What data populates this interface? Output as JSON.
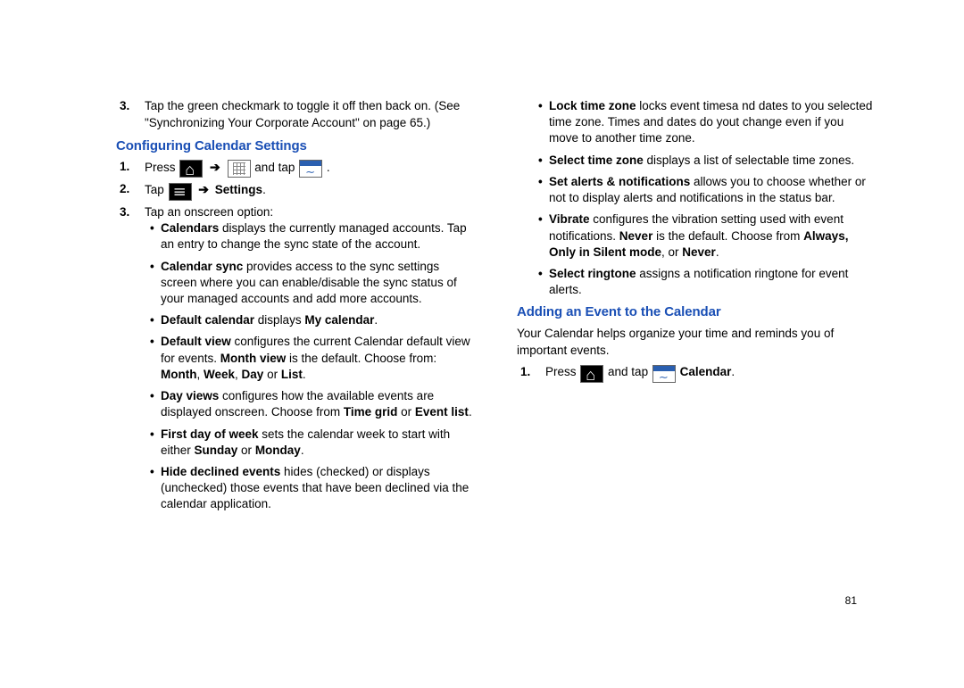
{
  "page_number": "81",
  "col1": {
    "pre_num": "3.",
    "pre_text": "Tap the green checkmark to toggle it off then back on. (See \"Synchronizing Your Corporate Account\" on page 65.)",
    "heading1": "Configuring Calendar Settings",
    "s1_n": "1.",
    "s1_a": "Press ",
    "s1_b": " and tap ",
    "s1_c": ".",
    "s2_n": "2.",
    "s2_a": "Tap ",
    "s2_b": "Settings",
    "s2_c": ".",
    "s3_n": "3.",
    "s3_a": "Tap an onscreen option:",
    "b1_a": "Calendars",
    "b1_b": " displays the currently managed accounts. Tap an entry to change the sync state of the account.",
    "b2_a": "Calendar sync",
    "b2_b": " provides access to the sync settings screen where you can enable/disable the sync status of your managed accounts and add more accounts.",
    "b3_a": "Default calendar",
    "b3_b": " displays ",
    "b3_c": "My calendar",
    "b3_d": ".",
    "b4_a": "Default view",
    "b4_b": " configures the current Calendar default view for events. ",
    "b4_c": "Month view",
    "b4_d": " is the default. Choose from: ",
    "b4_e": "Month",
    "b4_f": ", ",
    "b4_g": "Week",
    "b4_h": ", ",
    "b4_i": "Day",
    "b4_j": " or ",
    "b4_k": "List",
    "b4_l": ".",
    "b5_a": "Day views",
    "b5_b": " configures how the available events are displayed onscreen. Choose from ",
    "b5_c": "Time grid",
    "b5_d": " or ",
    "b5_e": "Event list",
    "b5_f": ".",
    "b6_a": "First day of week",
    "b6_b": " sets the calendar week to start with either ",
    "b6_c": "Sunday",
    "b6_d": " or ",
    "b6_e": "Monday",
    "b6_f": ".",
    "b7_a": "Hide declined events",
    "b7_b": " hides (checked) or displays (unchecked) those events that have been declined via the calendar application."
  },
  "col2": {
    "c1_a": "Lock time zone",
    "c1_b": " locks event timesa nd dates to you selected time zone. Times and dates do yout change even if you move to another time zone.",
    "c2_a": "Select time zone",
    "c2_b": " displays a list of selectable time zones.",
    "c3_a": "Set alerts & notifications",
    "c3_b": " allows you to choose whether or not to display alerts and notifications in the status bar.",
    "c4_a": "Vibrate",
    "c4_b": " configures the vibration setting used with event notifications. ",
    "c4_c": "Never",
    "c4_d": " is the default. Choose from ",
    "c4_e": "Always, Only in Silent mode",
    "c4_f": ", or ",
    "c4_g": "Never",
    "c4_h": ".",
    "c5_a": "Select ringtone",
    "c5_b": " assigns a notification ringtone for event alerts.",
    "heading2": "Adding an Event to the Calendar",
    "intro2": "Your Calendar helps organize your time and reminds you of important events.",
    "r1_n": "1.",
    "r1_a": "Press ",
    "r1_b": " and tap ",
    "r1_c": "Calendar",
    "r1_d": "."
  }
}
